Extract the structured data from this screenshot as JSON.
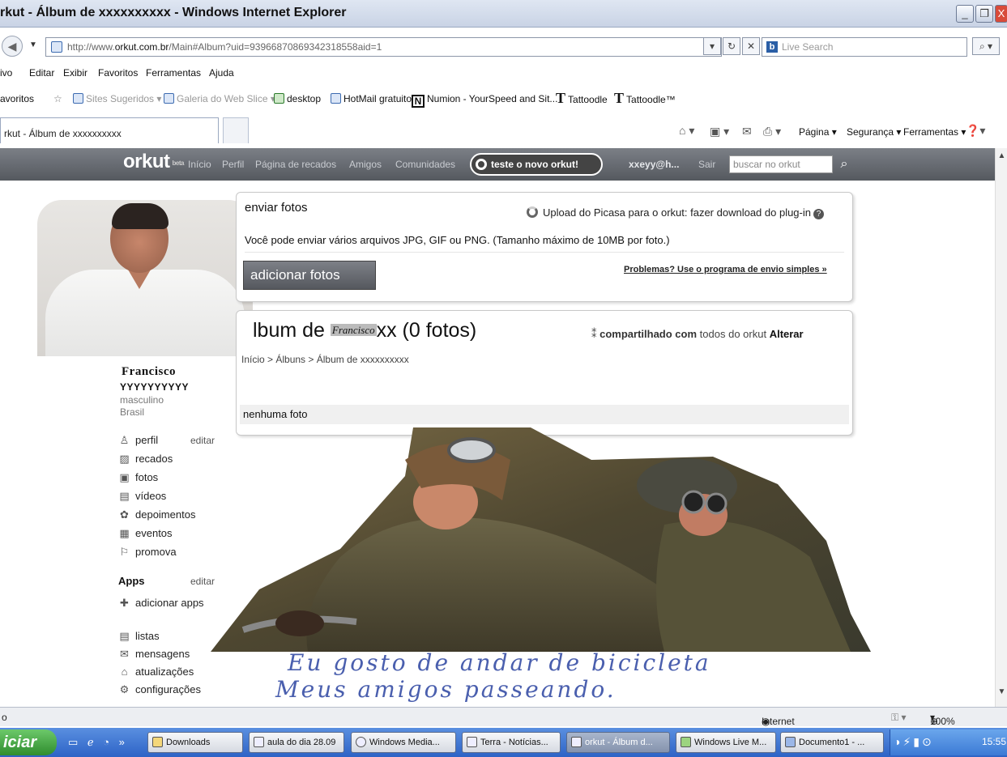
{
  "window": {
    "title": "rkut - Álbum de xxxxxxxxxx - Windows Internet Explorer",
    "min": "_",
    "max": "❐",
    "close": "X"
  },
  "address": {
    "url_prefix": "http://www.",
    "url_domain": "orkut.com.br",
    "url_rest": "/Main#Album?uid=939668708693423185​58aid=1",
    "live_search_placeholder": "Live Search"
  },
  "menu": [
    "ivo",
    "Editar",
    "Exibir",
    "Favoritos",
    "Ferramentas",
    "Ajuda"
  ],
  "favorites": {
    "label": "avoritos",
    "items": [
      "Sites Sugeridos ▾",
      "Galeria do Web Slice ▾",
      "desktop",
      "HotMail gratuito",
      "Numion - YourSpeed and Sit...",
      "Tattoodle",
      "Tattoodle™"
    ]
  },
  "tab": {
    "label": "rkut - Álbum de xxxxxxxxxx"
  },
  "commandbar": [
    "Página ▾",
    "Segurança ▾",
    "Ferramentas ▾"
  ],
  "orkut": {
    "logo": "orkut",
    "logo_sub": "beta",
    "nav": [
      "Início",
      "Perfil",
      "Página de recados",
      "Amigos",
      "Comunidades"
    ],
    "try_new": "teste o novo orkut!",
    "user": "xxeyy@h...",
    "logout": "Sair",
    "search_placeholder": "buscar no orkut"
  },
  "profile": {
    "name": "Francisco",
    "surname": "YYYYYYYYYY",
    "gender": "masculino",
    "country": "Brasil",
    "edit": "editar",
    "menu": [
      {
        "icon": "♙",
        "label": "perfil"
      },
      {
        "icon": "▨",
        "label": "recados"
      },
      {
        "icon": "▣",
        "label": "fotos"
      },
      {
        "icon": "▤",
        "label": "vídeos"
      },
      {
        "icon": "✿",
        "label": "depoimentos"
      },
      {
        "icon": "▦",
        "label": "eventos"
      },
      {
        "icon": "⚐",
        "label": "promova"
      }
    ],
    "apps_title": "Apps",
    "apps_edit": "editar",
    "add_apps": "adicionar apps",
    "tools": [
      {
        "icon": "▤",
        "label": "listas"
      },
      {
        "icon": "✉",
        "label": "mensagens"
      },
      {
        "icon": "⌂",
        "label": "atualizações"
      },
      {
        "icon": "⚙",
        "label": "configurações"
      }
    ]
  },
  "upload": {
    "title": "enviar fotos",
    "picasa": "Upload do Picasa para o orkut: fazer download do plug-in",
    "description": "Você pode enviar vários arquivos JPG, GIF ou PNG. (Tamanho máximo de 10MB por foto.)",
    "add_button": "adicionar fotos",
    "problems_link": "Problemas? Use o programa de envio simples »"
  },
  "album": {
    "title_start": "lbum de ",
    "title_pasted": "Francisco",
    "title_end": "xx (0 fotos)",
    "share_prefix": "compartilhado com",
    "share_mid": "todos do orkut",
    "share_action": "Alterar",
    "breadcrumb": "Início > Álbuns > Álbum de xxxxxxxxxx",
    "empty": "nenhuma foto"
  },
  "handwriting": {
    "line1": "Eu gosto de andar de bicicleta",
    "line2": "Meus amigos passeando."
  },
  "status": {
    "left": "o",
    "zone": "Internet",
    "zoom": "100%"
  },
  "taskbar": {
    "start": "iciar",
    "items": [
      "Downloads",
      "aula do dia 28.09",
      "Windows Media...",
      "Terra - Notícias...",
      "orkut - Álbum d...",
      "Windows Live M...",
      "Documento1 - ..."
    ],
    "clock": "15:55"
  },
  "colors": {
    "orkut_bar": "#5f6369",
    "handwriting": "#4a5fae",
    "taskbar": "#2d63c6"
  }
}
